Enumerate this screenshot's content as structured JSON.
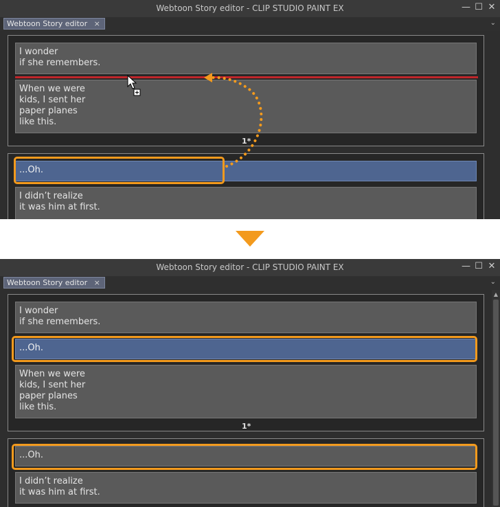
{
  "window": {
    "title": "Webtoon Story editor - CLIP STUDIO PAINT EX",
    "tab_label": "Webtoon Story editor",
    "tab_close": "×",
    "menu_glyph": "⌄",
    "controls": {
      "minimize": "—",
      "maximize": "☐",
      "close": "✕"
    }
  },
  "before": {
    "page1_blocks": [
      "I wonder\nif she remembers.",
      "When we were\nkids, I sent her\npaper planes\nlike this."
    ],
    "page_label": "1*",
    "page2_blocks": [
      "...Oh.",
      "I didn’t realize\nit was him at first."
    ]
  },
  "after": {
    "page1_blocks": [
      "I wonder\nif she remembers.",
      "...Oh.",
      "When we were\nkids, I sent her\npaper planes\nlike this."
    ],
    "page_label": "1*",
    "page2_blocks": [
      "...Oh.",
      "I didn’t realize\nit was him at first."
    ]
  },
  "colors": {
    "accent_orange": "#f39a1d",
    "insert_line_red": "#c0262b",
    "selected_block": "#4e6590"
  },
  "icons": {
    "cursor": "cursor-copy-icon",
    "transition": "triangle-down-icon"
  }
}
